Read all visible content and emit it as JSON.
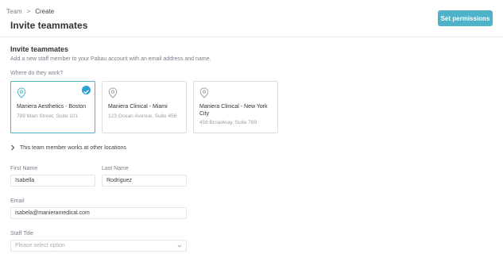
{
  "breadcrumb": {
    "parent": "Team",
    "separator": ">",
    "current": "Create"
  },
  "header": {
    "title": "Invite teammates",
    "action_label": "Set permissions"
  },
  "section": {
    "title": "Invite teammates",
    "description": "Add a new staff member to your Pabau account with an email address and name.",
    "where_label": "Where do they work?"
  },
  "locations": [
    {
      "name": "Maniera Aesthetics - Boston",
      "address": "789 Main Street, Suite 101",
      "selected": true
    },
    {
      "name": "Maniera Clinical - Miami",
      "address": "123 Ocean Avenue, Suite 456",
      "selected": false
    },
    {
      "name": "Maniera Clinical - New York City",
      "address": "456 Broadway, Suite 789",
      "selected": false
    }
  ],
  "other_locations_label": "This team member works at other locations",
  "form": {
    "first_name_label": "First Name",
    "first_name_value": "Isabella",
    "last_name_label": "Last Name",
    "last_name_value": "Rodriguez",
    "email_label": "Email",
    "email_value": "isabela@manieramedical.com",
    "staff_title_label": "Staff Title",
    "staff_title_placeholder": "Please select option"
  },
  "colors": {
    "accent": "#4eb3c8",
    "check": "#2aa3d6",
    "border": "#dadde1"
  },
  "icons": {
    "location": "map-pin-icon",
    "check": "check-circle-icon",
    "expand": "chevron-right-icon",
    "select": "chevron-down-icon"
  }
}
